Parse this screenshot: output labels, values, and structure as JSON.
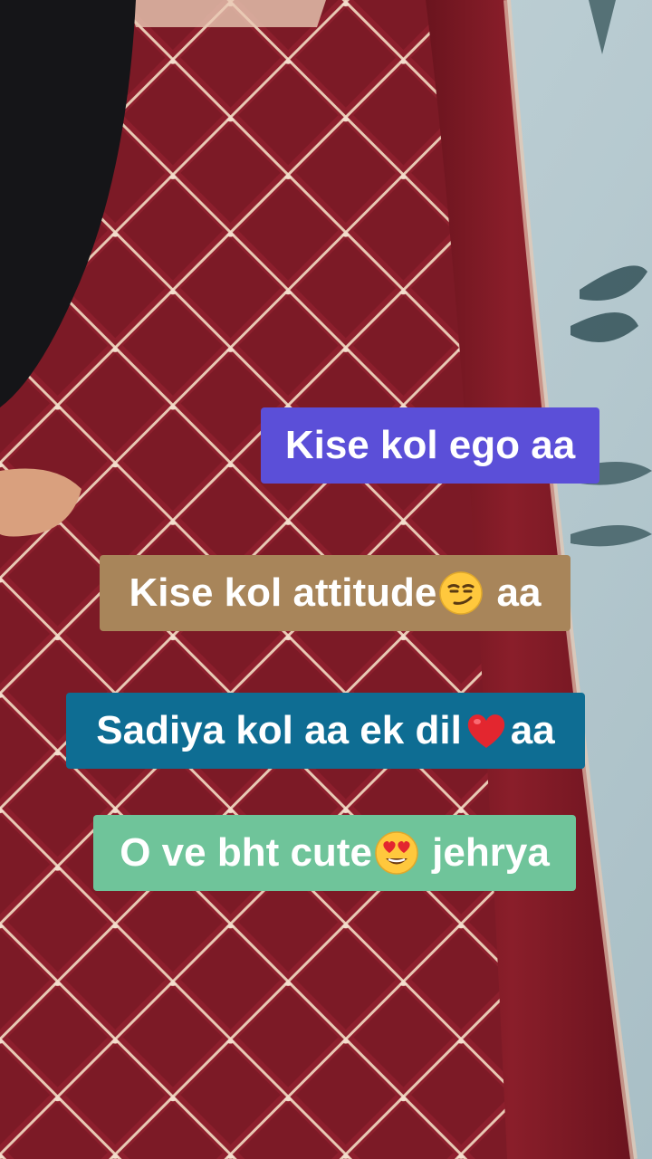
{
  "captions": [
    {
      "text": "Kise kol ego aa",
      "color": "#5b4fd8"
    },
    {
      "before": "Kise kol attitude",
      "emoji": "smirking-face-emoji",
      "after": " aa",
      "color": "#a8855a"
    },
    {
      "before": "Sadiya kol aa ek dil",
      "emoji": "red-heart-emoji",
      "after": "aa",
      "color": "#0e6d93"
    },
    {
      "before": "O ve bht cute",
      "emoji": "heart-eyes-emoji",
      "after": " jehrya",
      "color": "#6fc49a"
    }
  ],
  "background": {
    "dress_color": "#8a1f2b",
    "lattice_color": "#e8c9b4",
    "wall_color": "#b9ccd2",
    "hair_color": "#151518"
  }
}
